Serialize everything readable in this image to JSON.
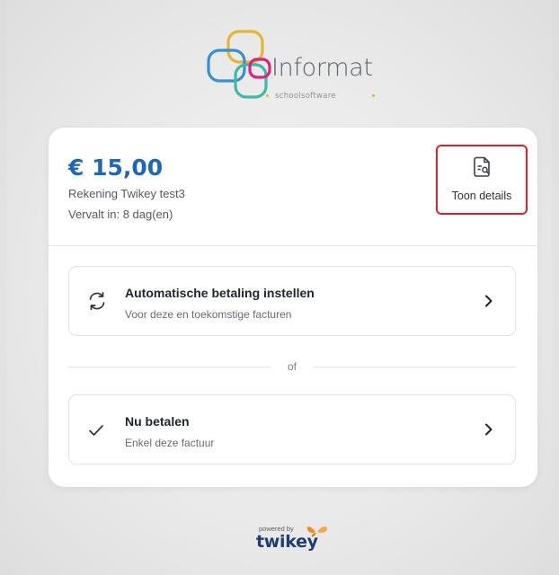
{
  "brand": {
    "name": "Informat",
    "tagline": "schoolsoftware",
    "colors": {
      "yellow": "#e7b533",
      "blue": "#3a8fd0",
      "teal": "#3fb8a8",
      "pink": "#d8267a"
    }
  },
  "invoice": {
    "amount": "€ 15,00",
    "name": "Rekening Twikey test3",
    "due": "Vervalt in: 8 dag(en)",
    "amount_color": "#1e67b6"
  },
  "details_button": {
    "label": "Toon details",
    "icon": "document-search-icon",
    "highlight_color": "#e31f26"
  },
  "options": [
    {
      "title": "Automatische betaling instellen",
      "subtitle": "Voor deze en toekomstige facturen",
      "icon": "sync-icon"
    },
    {
      "title": "Nu betalen",
      "subtitle": "Enkel deze factuur",
      "icon": "checkmark-icon"
    }
  ],
  "divider_text": "of",
  "footer": {
    "powered_by": "powered by",
    "provider": "twikey",
    "provider_icon": "butterfly-icon"
  }
}
